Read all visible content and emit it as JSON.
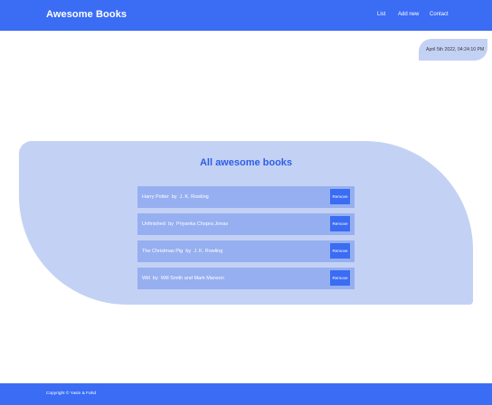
{
  "header": {
    "brand": "Awesome Books",
    "nav": [
      "List",
      "Add new",
      "Contact"
    ]
  },
  "date": "April 5th 2022, 04:24:10 PM",
  "list": {
    "title": "All awesome books",
    "books": [
      {
        "title": "Harry Potter",
        "by": "by",
        "author": "J. K. Rowling",
        "remove_label": "Remove"
      },
      {
        "title": "Unfinished",
        "by": "by",
        "author": "Priyanka Chopra Jonas",
        "remove_label": "Remove"
      },
      {
        "title": "The Christmas Pig",
        "by": "by",
        "author": "J. K. Rowling",
        "remove_label": "Remove"
      },
      {
        "title": "Will",
        "by": "by",
        "author": "Will Smith and Mark Manson",
        "remove_label": "Remove"
      }
    ]
  },
  "footer": {
    "copyright": "Copyright © Yasin & Fahd"
  },
  "colors": {
    "primary": "#3a6cf4",
    "panel": "#c3d1f4",
    "book_row": "#96aff0",
    "title": "#2f5ee6"
  }
}
